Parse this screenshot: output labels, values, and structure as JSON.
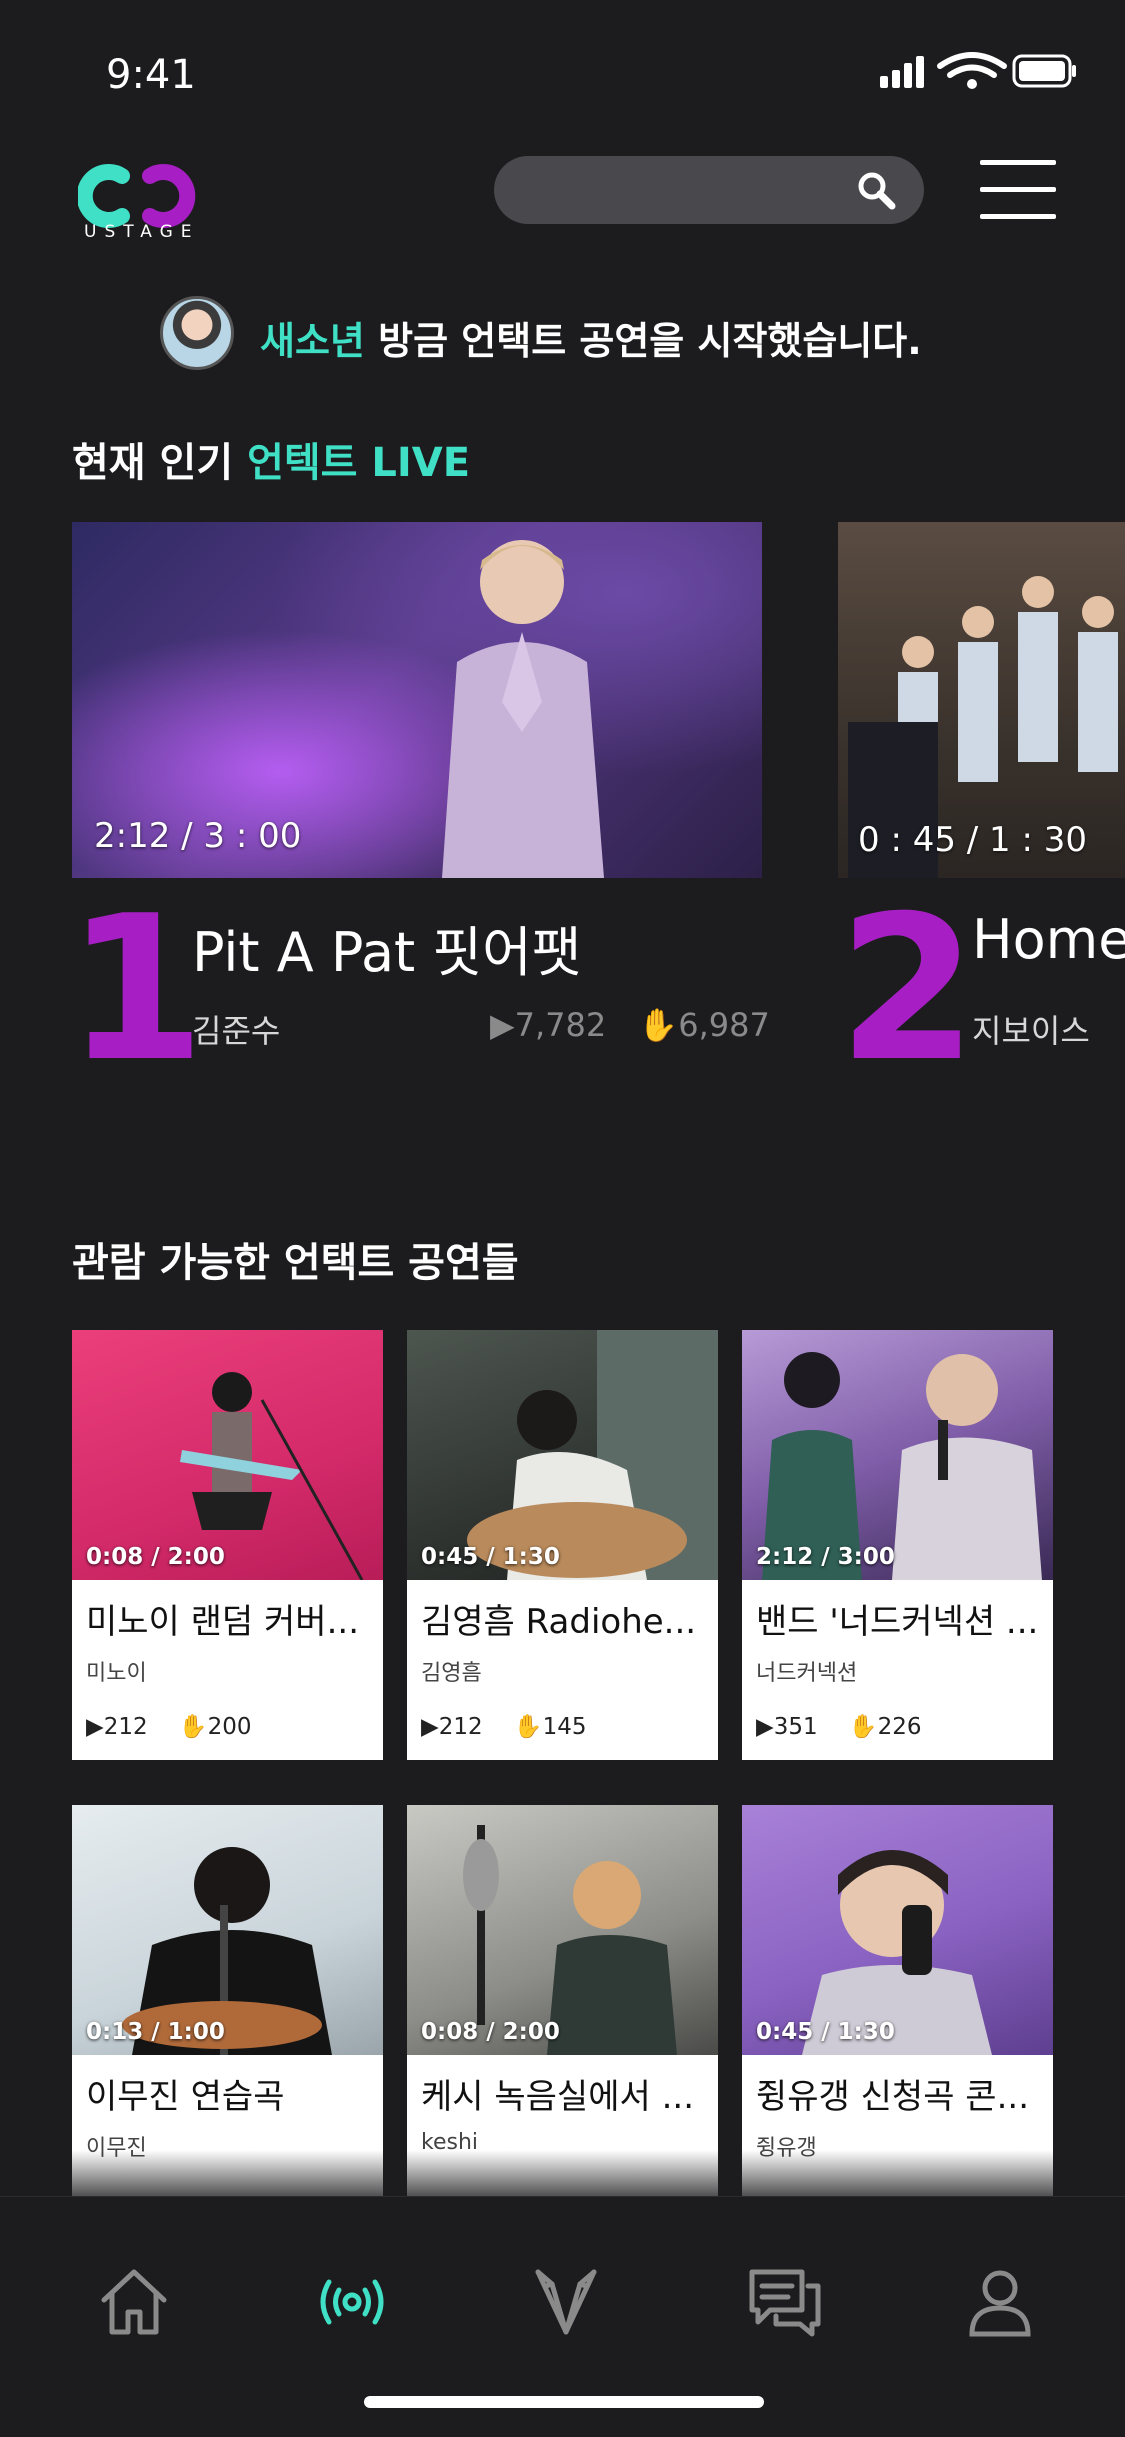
{
  "status_bar": {
    "time": "9:41"
  },
  "header": {
    "logo_text": "USTAGE"
  },
  "notice": {
    "name": "새소년",
    "text": "방금 언택트 공연을 시작했습니다."
  },
  "live_section": {
    "title_prefix": "현재 인기",
    "title_accent": "언텍트 LIVE",
    "items": [
      {
        "rank": "1",
        "time": "2:12 / 3 : 00",
        "title": "Pit A Pat 핏어팻",
        "artist": "김준수",
        "plays": "7,782",
        "likes": "6,987"
      },
      {
        "rank": "2",
        "time": "0 : 45 / 1 : 30",
        "title": "Home",
        "artist": "지보이스"
      }
    ]
  },
  "available_section": {
    "title": "관람 가능한 언택트 공연들",
    "cards": [
      {
        "time": "0:08 / 2:00",
        "title": "미노이 랜덤 커버...",
        "artist": "미노이",
        "plays": "212",
        "likes": "200"
      },
      {
        "time": "0:45 / 1:30",
        "title": "김영흠 Radiohe...",
        "artist": "김영흠",
        "plays": "212",
        "likes": "145"
      },
      {
        "time": "2:12 / 3:00",
        "title": "밴드 '너드커넥션 ...",
        "artist": "너드커넥션",
        "plays": "351",
        "likes": "226"
      },
      {
        "time": "0:13 / 1:00",
        "title": "이무진 연습곡",
        "artist": "이무진"
      },
      {
        "time": "0:08 / 2:00",
        "title": "케시 녹음실에서 ...",
        "artist": "keshi"
      },
      {
        "time": "0:45 / 1:30",
        "title": "쥥유갱 신청곡 콘...",
        "artist": "쥥유갱"
      }
    ]
  },
  "tab_bar": {
    "icons": [
      "home-icon",
      "live-icon",
      "stage-icon",
      "chat-icon",
      "profile-icon"
    ],
    "active_color": "#3fe0c5",
    "inactive_color": "#8a8a8a"
  },
  "colors": {
    "accent": "#3fe0c5",
    "rank": "#a71fc4",
    "background": "#1c1c1e"
  }
}
